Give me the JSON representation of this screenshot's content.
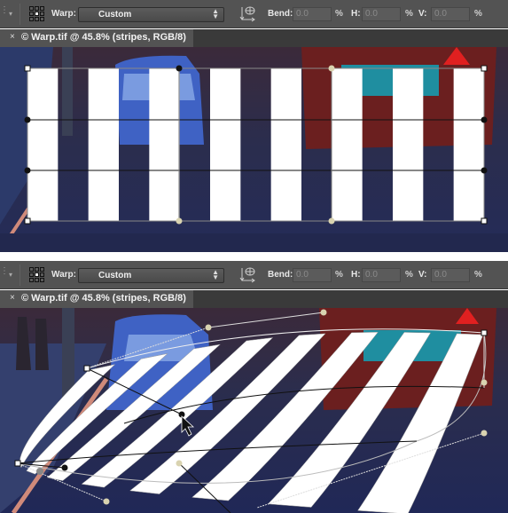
{
  "panels": [
    {
      "options_bar": {
        "warp_label": "Warp:",
        "warp_style": "Custom",
        "bend_label": "Bend:",
        "bend_value": "0.0",
        "h_label": "H:",
        "h_value": "0.0",
        "v_label": "V:",
        "v_value": "0.0",
        "percent": "%"
      },
      "document_tab": {
        "close": "×",
        "title": "© Warp.tif @ 45.8% (stripes, RGB/8)"
      },
      "state": "unwarped grid"
    },
    {
      "options_bar": {
        "warp_label": "Warp:",
        "warp_style": "Custom",
        "bend_label": "Bend:",
        "bend_value": "0.0",
        "h_label": "H:",
        "h_value": "0.0",
        "v_label": "V:",
        "v_value": "0.0",
        "percent": "%"
      },
      "document_tab": {
        "close": "×",
        "title": "© Warp.tif @ 45.8% (stripes, RGB/8)"
      },
      "state": "custom warp applied"
    }
  ],
  "icons": {
    "close": "×",
    "select_arrows": "⬍"
  },
  "colors": {
    "toolbar_bg": "#535353",
    "tab_bg": "#535353",
    "tabbar_bg": "#3a3a3a",
    "stripe": "#ffffff",
    "street": "#26305a",
    "handle": "#d9d3b0"
  }
}
